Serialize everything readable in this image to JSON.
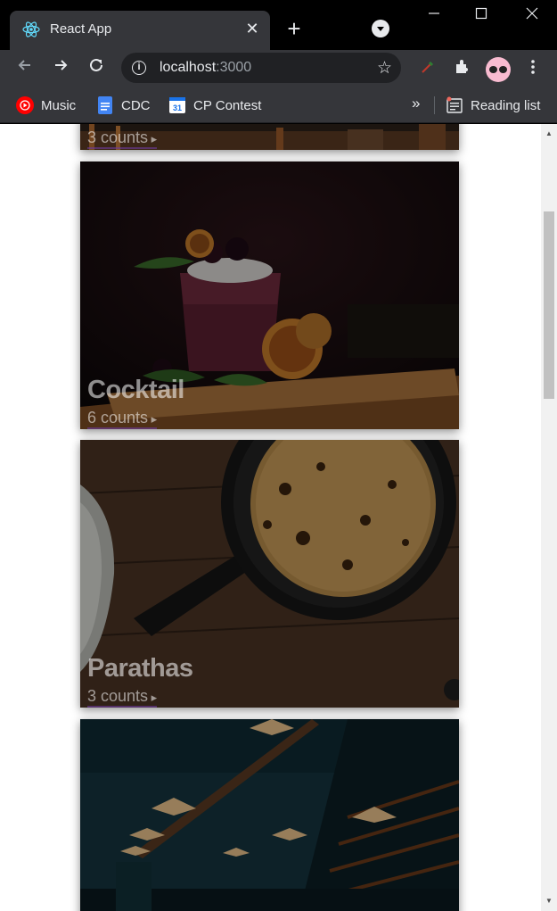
{
  "browser": {
    "tab_title": "React App",
    "tab_close": "✕",
    "new_tab": "+",
    "url_host": "localhost",
    "url_port": ":3000",
    "bookmarks": [
      {
        "label": "Music",
        "icon": "youtube-music-icon",
        "color": "#ff0000"
      },
      {
        "label": "CDC",
        "icon": "google-docs-icon",
        "color": "#4285f4"
      },
      {
        "label": "CP Contest",
        "icon": "google-calendar-icon",
        "color": "#1a73e8"
      }
    ],
    "overflow": "»",
    "reading_list": "Reading list"
  },
  "cards": [
    {
      "title": "",
      "count": "3 counts"
    },
    {
      "title": "Cocktail",
      "count": "6 counts"
    },
    {
      "title": "Parathas",
      "count": "3 counts"
    },
    {
      "title": "",
      "count": ""
    }
  ]
}
